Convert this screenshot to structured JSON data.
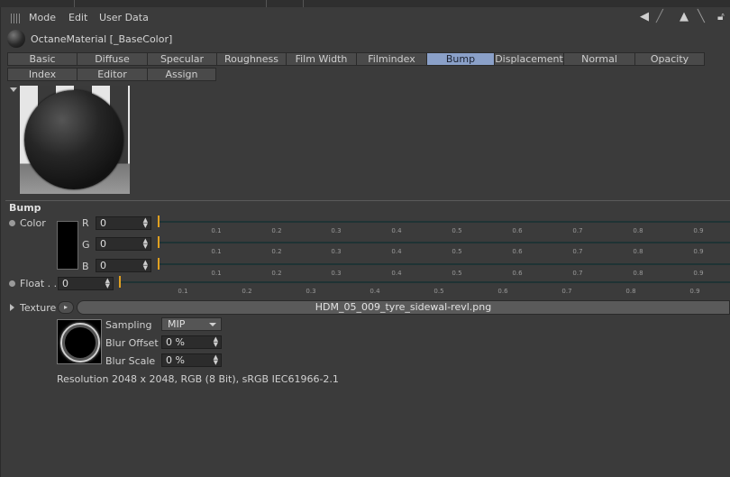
{
  "menubar": {
    "items": [
      "Mode",
      "Edit",
      "User Data"
    ]
  },
  "nav_icons": [
    "arrow-left-icon",
    "arrow-diagonal-icon",
    "arrow-up-icon",
    "lock-icon"
  ],
  "material": {
    "title": "OctaneMaterial [_BaseColor]"
  },
  "tabs": {
    "row1": [
      "Basic",
      "Diffuse",
      "Specular",
      "Roughness",
      "Film Width",
      "Filmindex",
      "Bump",
      "Displacement",
      "Normal",
      "Opacity"
    ],
    "row2": [
      "Index",
      "Editor",
      "Assign"
    ],
    "active": "Bump"
  },
  "section": {
    "title": "Bump"
  },
  "color": {
    "label": "Color",
    "swatch": "#000000",
    "channels": [
      {
        "name": "R",
        "value": "0",
        "slider": 0
      },
      {
        "name": "G",
        "value": "0",
        "slider": 0
      },
      {
        "name": "B",
        "value": "0",
        "slider": 0
      }
    ],
    "ticks": [
      "0.1",
      "0.2",
      "0.3",
      "0.4",
      "0.5",
      "0.6",
      "0.7",
      "0.8",
      "0.9"
    ]
  },
  "float": {
    "label": "Float . .",
    "value": "0",
    "slider": 0,
    "ticks": [
      "0.1",
      "0.2",
      "0.3",
      "0.4",
      "0.5",
      "0.6",
      "0.7",
      "0.8",
      "0.9"
    ]
  },
  "texture": {
    "label": "Texture",
    "button_glyph": "▸",
    "file": "HDM_05_009_tyre_sidewal-revl.png",
    "sampling_label": "Sampling",
    "sampling_value": "MIP",
    "blur_offset_label": "Blur Offset",
    "blur_offset_value": "0 %",
    "blur_scale_label": "Blur Scale",
    "blur_scale_value": "0 %",
    "resolution": "Resolution 2048 x 2048, RGB (8 Bit), sRGB IEC61966-2.1"
  },
  "colors": {
    "accent": "#8aa0c8",
    "knob": "#e0a020"
  }
}
